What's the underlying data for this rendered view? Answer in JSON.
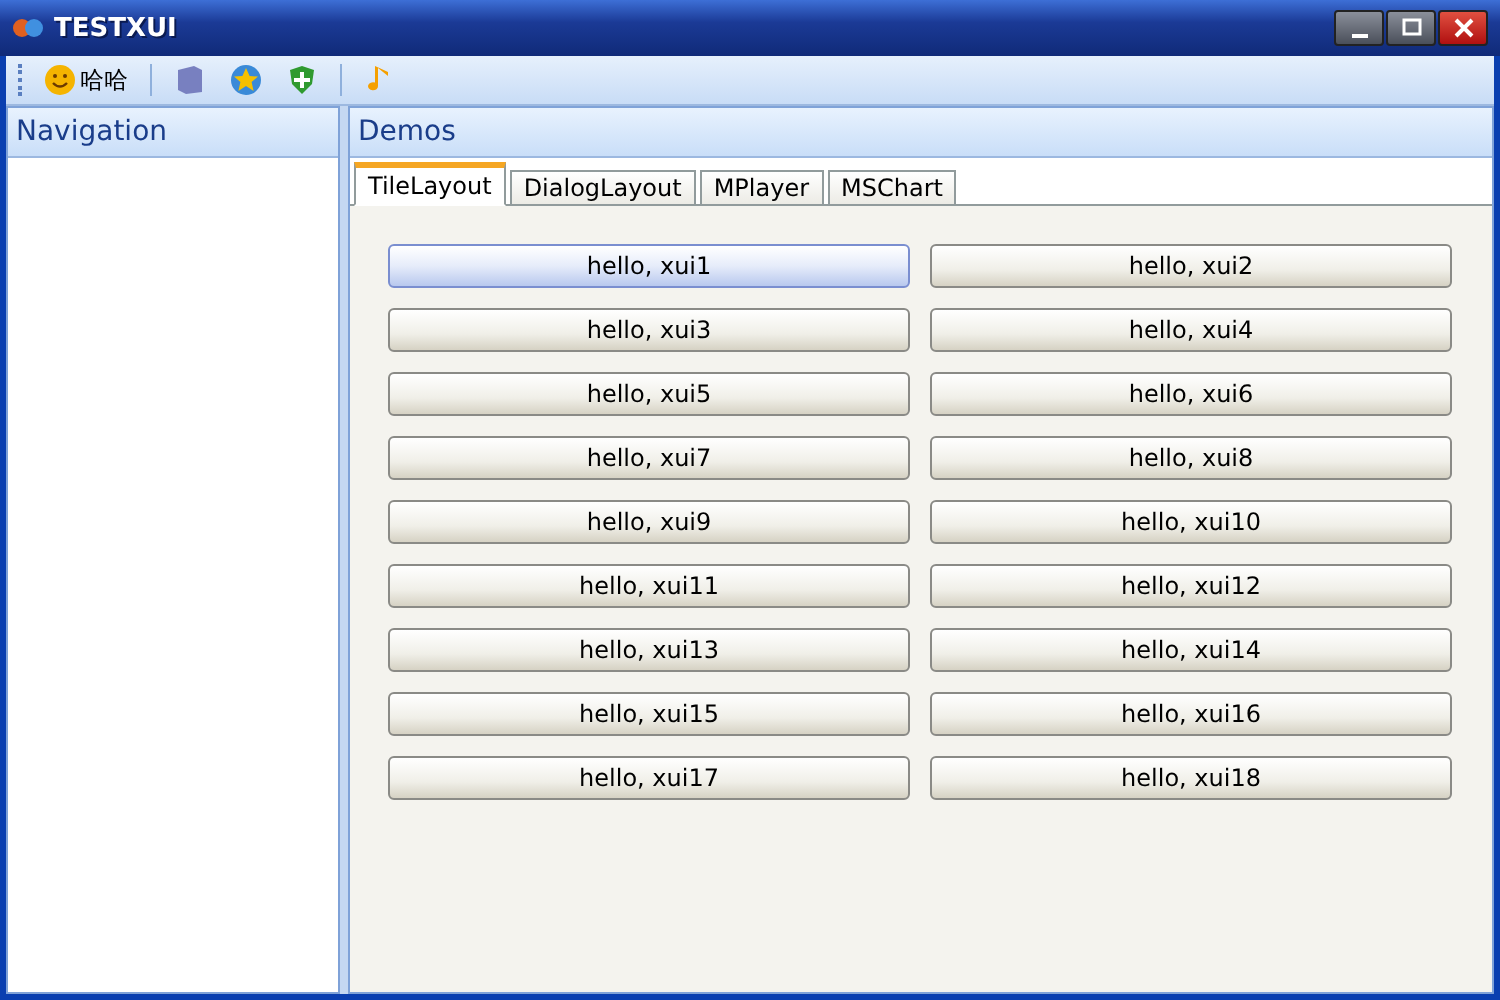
{
  "window": {
    "title": "TESTXUI"
  },
  "toolbar": [
    {
      "kind": "button",
      "label": "哈哈"
    },
    {
      "kind": "separator"
    },
    {
      "kind": "button"
    },
    {
      "kind": "button"
    },
    {
      "kind": "button"
    },
    {
      "kind": "separator"
    },
    {
      "kind": "button"
    }
  ],
  "navigation": {
    "title": "Navigation"
  },
  "demos": {
    "title": "Demos"
  },
  "tabs": [
    {
      "label": "TileLayout",
      "selected": true
    },
    {
      "label": "DialogLayout",
      "selected": false
    },
    {
      "label": "MPlayer",
      "selected": false
    },
    {
      "label": "MSChart",
      "selected": false
    }
  ],
  "buttons": [
    {
      "label": "hello, xui1",
      "focused": true
    },
    {
      "label": "hello, xui2",
      "focused": false
    },
    {
      "label": "hello, xui3",
      "focused": false
    },
    {
      "label": "hello, xui4",
      "focused": false
    },
    {
      "label": "hello, xui5",
      "focused": false
    },
    {
      "label": "hello, xui6",
      "focused": false
    },
    {
      "label": "hello, xui7",
      "focused": false
    },
    {
      "label": "hello, xui8",
      "focused": false
    },
    {
      "label": "hello, xui9",
      "focused": false
    },
    {
      "label": "hello, xui10",
      "focused": false
    },
    {
      "label": "hello, xui11",
      "focused": false
    },
    {
      "label": "hello, xui12",
      "focused": false
    },
    {
      "label": "hello, xui13",
      "focused": false
    },
    {
      "label": "hello, xui14",
      "focused": false
    },
    {
      "label": "hello, xui15",
      "focused": false
    },
    {
      "label": "hello, xui16",
      "focused": false
    },
    {
      "label": "hello, xui17",
      "focused": false
    },
    {
      "label": "hello, xui18",
      "focused": false
    }
  ]
}
